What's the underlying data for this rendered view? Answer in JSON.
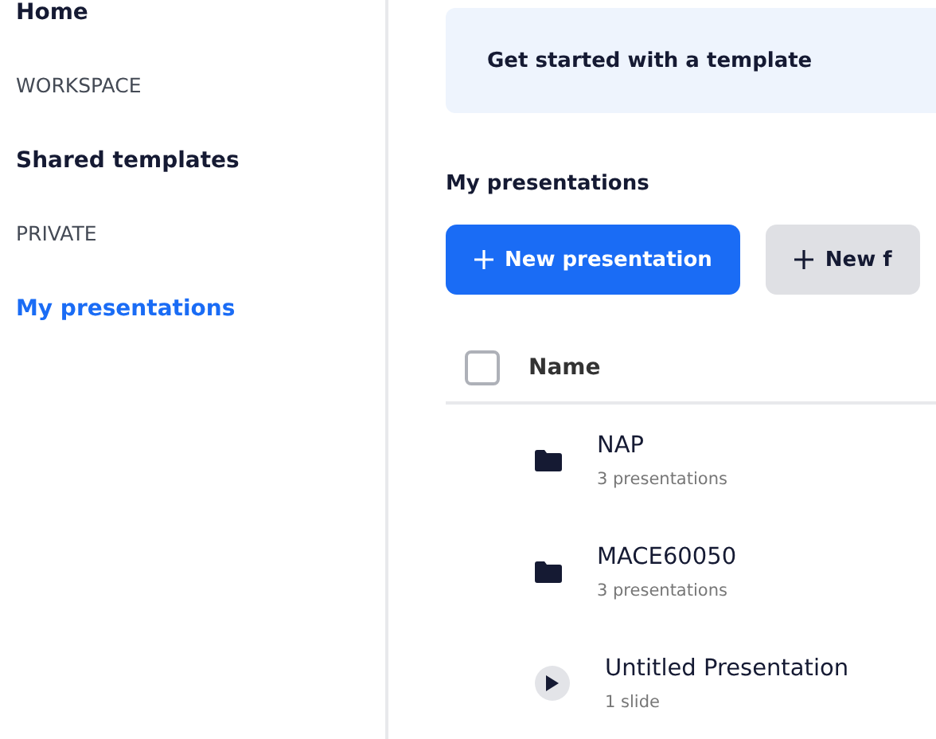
{
  "sidebar": {
    "items": [
      {
        "kind": "link",
        "label": "Home",
        "selected": false
      },
      {
        "kind": "heading",
        "label": "WORKSPACE"
      },
      {
        "kind": "link",
        "label": "Shared templates",
        "selected": false
      },
      {
        "kind": "heading",
        "label": "PRIVATE"
      },
      {
        "kind": "link",
        "label": "My presentations",
        "selected": true
      }
    ]
  },
  "banner": {
    "title": "Get started with a template"
  },
  "section_title": "My presentations",
  "buttons": [
    {
      "kind": "primary",
      "label": "New presentation"
    },
    {
      "kind": "secondary",
      "label": "New f"
    }
  ],
  "table": {
    "select_all": {
      "checked": false
    },
    "columns": [
      "Name"
    ],
    "rows": [
      {
        "kind": "folder",
        "name": "NAP",
        "detail": "3 presentations"
      },
      {
        "kind": "folder",
        "name": "MACE60050",
        "detail": "3 presentations"
      },
      {
        "kind": "presentation",
        "name": "Untitled Presentation",
        "detail": "1 slide"
      }
    ]
  }
}
